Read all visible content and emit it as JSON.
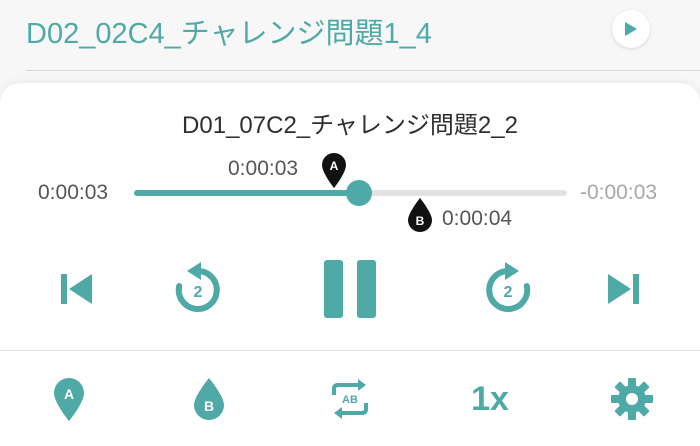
{
  "list": {
    "item_title": "D02_02C4_チャレンジ問題1_4"
  },
  "player": {
    "track_title": "D01_07C2_チャレンジ問題2_2",
    "elapsed": "0:00:03",
    "remaining": "-0:00:03",
    "marker_a_time": "0:00:03",
    "marker_b_time": "0:00:04",
    "progress_fraction": 0.52,
    "marker_b_fraction": 0.66,
    "skip_back_seconds": "2",
    "skip_forward_seconds": "2"
  },
  "toolbar": {
    "set_a_label": "A",
    "set_b_label": "B",
    "repeat_label": "AB",
    "speed": "1x"
  },
  "colors": {
    "accent": "#4fa9a6",
    "marker": "#111111"
  }
}
